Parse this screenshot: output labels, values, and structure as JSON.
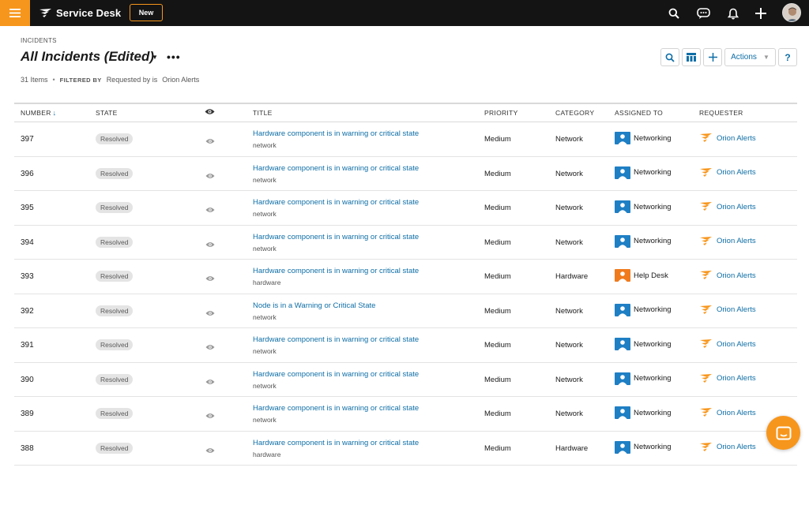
{
  "colors": {
    "accent": "#f7961c",
    "link": "#0e6ea6",
    "topbar": "#141414",
    "networking_team": "#1f7fc4",
    "helpdesk_team": "#f07b1d"
  },
  "topbar": {
    "brand": "Service Desk",
    "new_label": "New",
    "icons": [
      "menu-icon",
      "search-icon",
      "chat-icon",
      "bell-icon",
      "plus-icon",
      "avatar"
    ]
  },
  "header": {
    "breadcrumb": "INCIDENTS",
    "title": "All Incidents (Edited)",
    "count": "31 Items",
    "separator": "•",
    "filtered_by": "FILTERED BY",
    "filter": "Requested by is",
    "filter_value": "Orion Alerts"
  },
  "toolbar": {
    "actions_label": "Actions",
    "help_label": "?"
  },
  "table": {
    "columns": {
      "number": "NUMBER",
      "state": "STATE",
      "title": "TITLE",
      "priority": "PRIORITY",
      "category": "CATEGORY",
      "assigned_to": "ASSIGNED TO",
      "requester": "REQUESTER"
    },
    "rows": [
      {
        "number": "397",
        "state": "Resolved",
        "title": "Hardware component is in warning or critical state",
        "subtitle": "network",
        "priority": "Medium",
        "category": "Network",
        "assigned": "Networking",
        "team": "networking",
        "requester": "Orion Alerts"
      },
      {
        "number": "396",
        "state": "Resolved",
        "title": "Hardware component is in warning or critical state",
        "subtitle": "network",
        "priority": "Medium",
        "category": "Network",
        "assigned": "Networking",
        "team": "networking",
        "requester": "Orion Alerts"
      },
      {
        "number": "395",
        "state": "Resolved",
        "title": "Hardware component is in warning or critical state",
        "subtitle": "network",
        "priority": "Medium",
        "category": "Network",
        "assigned": "Networking",
        "team": "networking",
        "requester": "Orion Alerts"
      },
      {
        "number": "394",
        "state": "Resolved",
        "title": "Hardware component is in warning or critical state",
        "subtitle": "network",
        "priority": "Medium",
        "category": "Network",
        "assigned": "Networking",
        "team": "networking",
        "requester": "Orion Alerts"
      },
      {
        "number": "393",
        "state": "Resolved",
        "title": "Hardware component is in warning or critical state",
        "subtitle": "hardware",
        "priority": "Medium",
        "category": "Hardware",
        "assigned": "Help Desk",
        "team": "helpdesk",
        "requester": "Orion Alerts"
      },
      {
        "number": "392",
        "state": "Resolved",
        "title": "Node is in a Warning or Critical State",
        "subtitle": "network",
        "priority": "Medium",
        "category": "Network",
        "assigned": "Networking",
        "team": "networking",
        "requester": "Orion Alerts"
      },
      {
        "number": "391",
        "state": "Resolved",
        "title": "Hardware component is in warning or critical state",
        "subtitle": "network",
        "priority": "Medium",
        "category": "Network",
        "assigned": "Networking",
        "team": "networking",
        "requester": "Orion Alerts"
      },
      {
        "number": "390",
        "state": "Resolved",
        "title": "Hardware component is in warning or critical state",
        "subtitle": "network",
        "priority": "Medium",
        "category": "Network",
        "assigned": "Networking",
        "team": "networking",
        "requester": "Orion Alerts"
      },
      {
        "number": "389",
        "state": "Resolved",
        "title": "Hardware component is in warning or critical state",
        "subtitle": "network",
        "priority": "Medium",
        "category": "Network",
        "assigned": "Networking",
        "team": "networking",
        "requester": "Orion Alerts"
      },
      {
        "number": "388",
        "state": "Resolved",
        "title": "Hardware component is in warning or critical state",
        "subtitle": "hardware",
        "priority": "Medium",
        "category": "Hardware",
        "assigned": "Networking",
        "team": "networking",
        "requester": "Orion Alerts"
      }
    ]
  }
}
